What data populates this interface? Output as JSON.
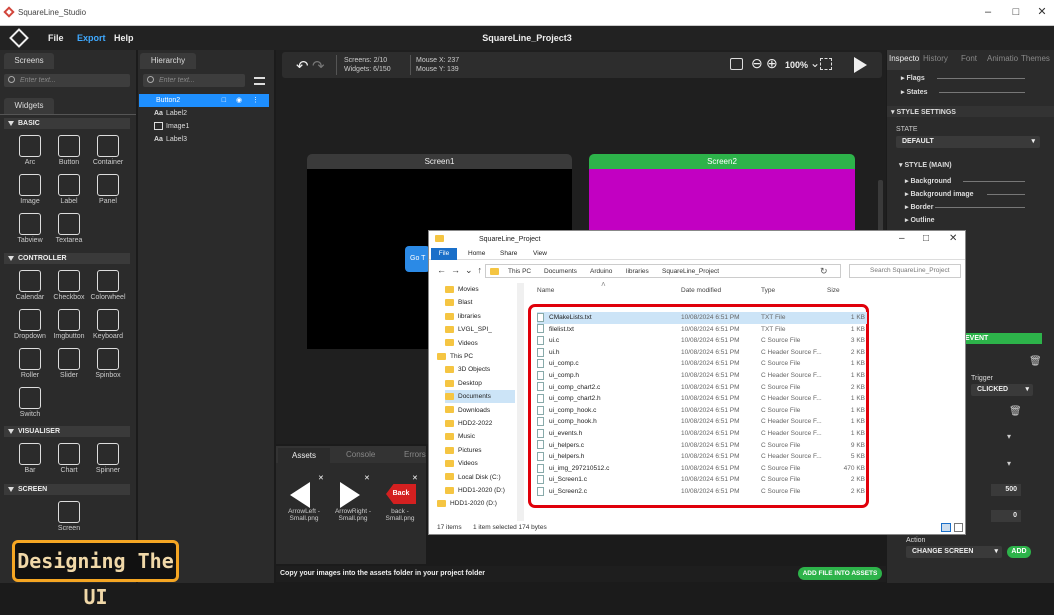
{
  "window": {
    "title": "SquareLine_Studio"
  },
  "menu": {
    "file": "File",
    "export": "Export",
    "help": "Help",
    "project_title": "SquareLine_Project3"
  },
  "left": {
    "screens_tab": "Screens",
    "screens_search_placeholder": "Enter text...",
    "widgets_tab": "Widgets",
    "sections": {
      "basic": "BASIC",
      "controller": "CONTROLLER",
      "visualiser": "VISUALISER",
      "screen": "SCREEN"
    },
    "basic": [
      "Arc",
      "Button",
      "Container",
      "Image",
      "Label",
      "Panel",
      "Tabview",
      "Textarea"
    ],
    "controller": [
      "Calendar",
      "Checkbox",
      "Colorwheel",
      "Dropdown",
      "Imgbutton",
      "Keyboard",
      "Roller",
      "Slider",
      "Spinbox",
      "Switch"
    ],
    "visualiser": [
      "Bar",
      "Chart",
      "Spinner"
    ],
    "screen": [
      "Screen"
    ]
  },
  "hierarchy": {
    "tab": "Hierarchy",
    "search_placeholder": "Enter text...",
    "items": [
      "Button2",
      "Label2",
      "Image1",
      "Label3"
    ]
  },
  "toolbar": {
    "screens": "Screens: 2/10",
    "widgets": "Widgets: 6/150",
    "mouse_x": "Mouse X: 237",
    "mouse_y": "Mouse Y: 139",
    "zoom": "100%"
  },
  "canvas": {
    "screen1": "Screen1",
    "screen2": "Screen2",
    "button_text": "Go T"
  },
  "bottom": {
    "tabs": [
      "Assets",
      "Console",
      "Errors"
    ],
    "assets": [
      {
        "name": "ArrowLeft - Small.png"
      },
      {
        "name": "ArrowRight - Small.png"
      },
      {
        "name": "back - Small.png",
        "label": "Back"
      }
    ],
    "status_msg": "Copy your images into the assets folder in your project folder",
    "add_file_button": "ADD FILE INTO ASSETS"
  },
  "inspector": {
    "tabs": [
      "Inspecto",
      "History",
      "Font",
      "Animatio",
      "Themes"
    ],
    "flags": "Flags",
    "states": "States",
    "style_settings": "STYLE SETTINGS",
    "state_label": "STATE",
    "state_value": "DEFAULT",
    "style_main": "STYLE (MAIN)",
    "style_props": [
      "Background",
      "Background image",
      "Border",
      "Outline"
    ],
    "event_label": "EVENT",
    "trigger_label": "Trigger",
    "trigger_value": "CLICKED",
    "value_500": "500",
    "value_0": "0",
    "action_label": "Action",
    "action_value": "CHANGE SCREEN",
    "add_button": "ADD"
  },
  "explorer": {
    "title": "SquareLine_Project",
    "ribbon": [
      "File",
      "Home",
      "Share",
      "View"
    ],
    "path": [
      "This PC",
      "Documents",
      "Arduino",
      "libraries",
      "SquareLine_Project"
    ],
    "search_placeholder": "Search SquareLine_Project",
    "nav": [
      "Movies",
      "Blast",
      "libraries",
      "LVGL_SPI_",
      "Videos",
      "This PC",
      "3D Objects",
      "Desktop",
      "Documents",
      "Downloads",
      "HDD2-2022",
      "Music",
      "Pictures",
      "Videos",
      "Local Disk (C:)",
      "HDD1-2020 (D:)",
      "HDD1-2020 (D:)"
    ],
    "columns": {
      "name": "Name",
      "date": "Date modified",
      "type": "Type",
      "size": "Size"
    },
    "files": [
      {
        "name": "CMakeLists.txt",
        "date": "10/08/2024 6:51 PM",
        "type": "TXT File",
        "size": "1 KB"
      },
      {
        "name": "filelist.txt",
        "date": "10/08/2024 6:51 PM",
        "type": "TXT File",
        "size": "1 KB"
      },
      {
        "name": "ui.c",
        "date": "10/08/2024 6:51 PM",
        "type": "C Source File",
        "size": "3 KB"
      },
      {
        "name": "ui.h",
        "date": "10/08/2024 6:51 PM",
        "type": "C Header Source F...",
        "size": "2 KB"
      },
      {
        "name": "ui_comp.c",
        "date": "10/08/2024 6:51 PM",
        "type": "C Source File",
        "size": "1 KB"
      },
      {
        "name": "ui_comp.h",
        "date": "10/08/2024 6:51 PM",
        "type": "C Header Source F...",
        "size": "1 KB"
      },
      {
        "name": "ui_comp_chart2.c",
        "date": "10/08/2024 6:51 PM",
        "type": "C Source File",
        "size": "2 KB"
      },
      {
        "name": "ui_comp_chart2.h",
        "date": "10/08/2024 6:51 PM",
        "type": "C Header Source F...",
        "size": "1 KB"
      },
      {
        "name": "ui_comp_hook.c",
        "date": "10/08/2024 6:51 PM",
        "type": "C Source File",
        "size": "1 KB"
      },
      {
        "name": "ui_comp_hook.h",
        "date": "10/08/2024 6:51 PM",
        "type": "C Header Source F...",
        "size": "1 KB"
      },
      {
        "name": "ui_events.h",
        "date": "10/08/2024 6:51 PM",
        "type": "C Header Source F...",
        "size": "1 KB"
      },
      {
        "name": "ui_helpers.c",
        "date": "10/08/2024 6:51 PM",
        "type": "C Source File",
        "size": "9 KB"
      },
      {
        "name": "ui_helpers.h",
        "date": "10/08/2024 6:51 PM",
        "type": "C Header Source F...",
        "size": "5 KB"
      },
      {
        "name": "ui_img_297210512.c",
        "date": "10/08/2024 6:51 PM",
        "type": "C Source File",
        "size": "470 KB"
      },
      {
        "name": "ui_Screen1.c",
        "date": "10/08/2024 6:51 PM",
        "type": "C Source File",
        "size": "2 KB"
      },
      {
        "name": "ui_Screen2.c",
        "date": "10/08/2024 6:51 PM",
        "type": "C Source File",
        "size": "2 KB"
      }
    ],
    "status_items": "17 items",
    "status_selected": "1 item selected  174 bytes"
  },
  "overlay": {
    "caption": "Designing The UI"
  },
  "colors": {
    "accent": "#1e90ff",
    "green": "#2db34a",
    "magenta": "#c200c2",
    "highlight_red": "#e0000a",
    "caption_orange": "#f5a623"
  }
}
